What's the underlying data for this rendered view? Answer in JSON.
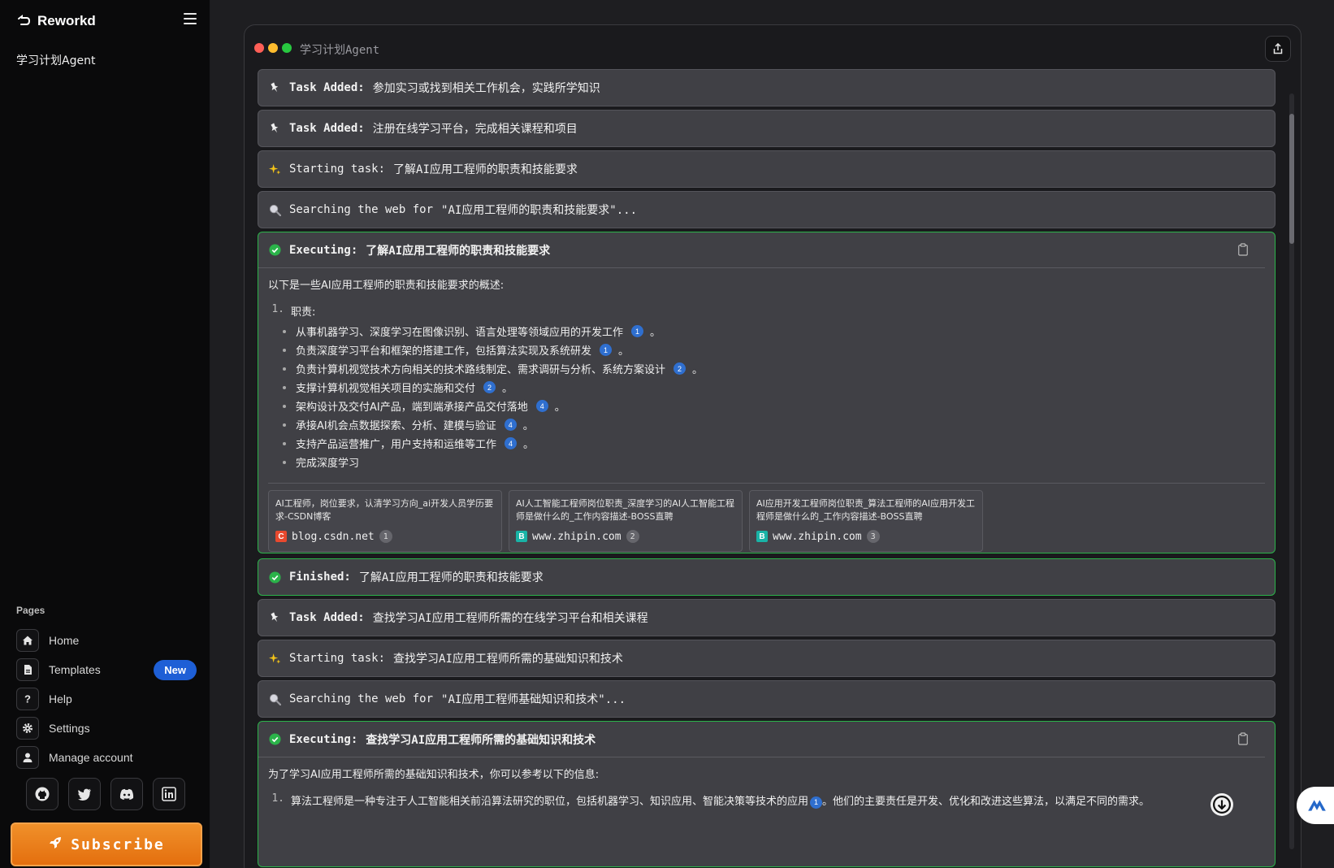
{
  "app": {
    "name": "Reworkd"
  },
  "sidebar": {
    "agents": [
      "学习计划Agent"
    ],
    "pages_label": "Pages",
    "nav": [
      {
        "label": "Home",
        "icon": "home-icon"
      },
      {
        "label": "Templates",
        "icon": "document-icon",
        "badge": "New"
      },
      {
        "label": "Help",
        "icon": "question-icon"
      },
      {
        "label": "Settings",
        "icon": "gear-icon"
      },
      {
        "label": "Manage account",
        "icon": "user-icon"
      }
    ],
    "socials": [
      "github-icon",
      "twitter-icon",
      "discord-icon",
      "linkedin-icon"
    ],
    "subscribe_label": "Subscribe"
  },
  "window": {
    "title": "学习计划Agent",
    "colors": {
      "red": "#ff5f57",
      "yellow": "#febc2e",
      "green": "#28c840",
      "accent_green": "#2bb34a"
    }
  },
  "messages": {
    "m1": {
      "label": "Task Added:",
      "text": "参加实习或找到相关工作机会，实践所学知识"
    },
    "m2": {
      "label": "Task Added:",
      "text": "注册在线学习平台，完成相关课程和项目"
    },
    "m3": {
      "label": "Starting task:",
      "text": "了解AI应用工程师的职责和技能要求"
    },
    "m4": {
      "label": "Searching the web for",
      "text": "\"AI应用工程师的职责和技能要求\"..."
    },
    "m5": {
      "label": "Executing:",
      "text": "了解AI应用工程师的职责和技能要求",
      "intro": "以下是一些AI应用工程师的职责和技能要求的概述:",
      "list_num": "1.",
      "list_head": "职责:",
      "bullets": [
        {
          "text": "从事机器学习、深度学习在图像识别、语言处理等领域应用的开发工作",
          "cite": "1",
          "end": "。"
        },
        {
          "text": "负责深度学习平台和框架的搭建工作，包括算法实现及系统研发",
          "cite": "1",
          "end": "。"
        },
        {
          "text": "负责计算机视觉技术方向相关的技术路线制定、需求调研与分析、系统方案设计",
          "cite": "2",
          "end": "。"
        },
        {
          "text": "支撑计算机视觉相关项目的实施和交付",
          "cite": "2",
          "end": "。"
        },
        {
          "text": "架构设计及交付AI产品，端到端承接产品交付落地",
          "cite": "4",
          "end": "。"
        },
        {
          "text": "承接AI机会点数据探索、分析、建模与验证",
          "cite": "4",
          "end": "。"
        },
        {
          "text": "支持产品运营推广，用户支持和运维等工作",
          "cite": "4",
          "end": "。"
        },
        {
          "text": "完成深度学习",
          "cite": "",
          "end": ""
        }
      ],
      "sources": [
        {
          "title": "AI工程师，岗位要求，认清学习方向_ai开发人员学历要求-CSDN博客",
          "favicon": "C",
          "domain": "blog.csdn.net",
          "num": "1"
        },
        {
          "title": "AI人工智能工程师岗位职责_深度学习的AI人工智能工程师是做什么的_工作内容描述-BOSS直聘",
          "favicon": "B",
          "domain": "www.zhipin.com",
          "num": "2"
        },
        {
          "title": "AI应用开发工程师岗位职责_算法工程师的AI应用开发工程师是做什么的_工作内容描述-BOSS直聘",
          "favicon": "B",
          "domain": "www.zhipin.com",
          "num": "3"
        }
      ]
    },
    "m6": {
      "label": "Finished:",
      "text": "了解AI应用工程师的职责和技能要求"
    },
    "m7": {
      "label": "Task Added:",
      "text": "查找学习AI应用工程师所需的在线学习平台和相关课程"
    },
    "m8": {
      "label": "Starting task:",
      "text": "查找学习AI应用工程师所需的基础知识和技术"
    },
    "m9": {
      "label": "Searching the web for",
      "text": "\"AI应用工程师基础知识和技术\"..."
    },
    "m10": {
      "label": "Executing:",
      "text": "查找学习AI应用工程师所需的基础知识和技术",
      "intro": "为了学习AI应用工程师所需的基础知识和技术，你可以参考以下的信息:",
      "item1_num": "1.",
      "item1": "算法工程师是一种专注于人工智能相关前沿算法研究的职位，包括机器学习、知识应用、智能决策等技术的应用",
      "item1_cite": "1",
      "item1_end": "。他们的主要责任是开发、优化和改进这些算法，以满足不同的需求。"
    }
  }
}
